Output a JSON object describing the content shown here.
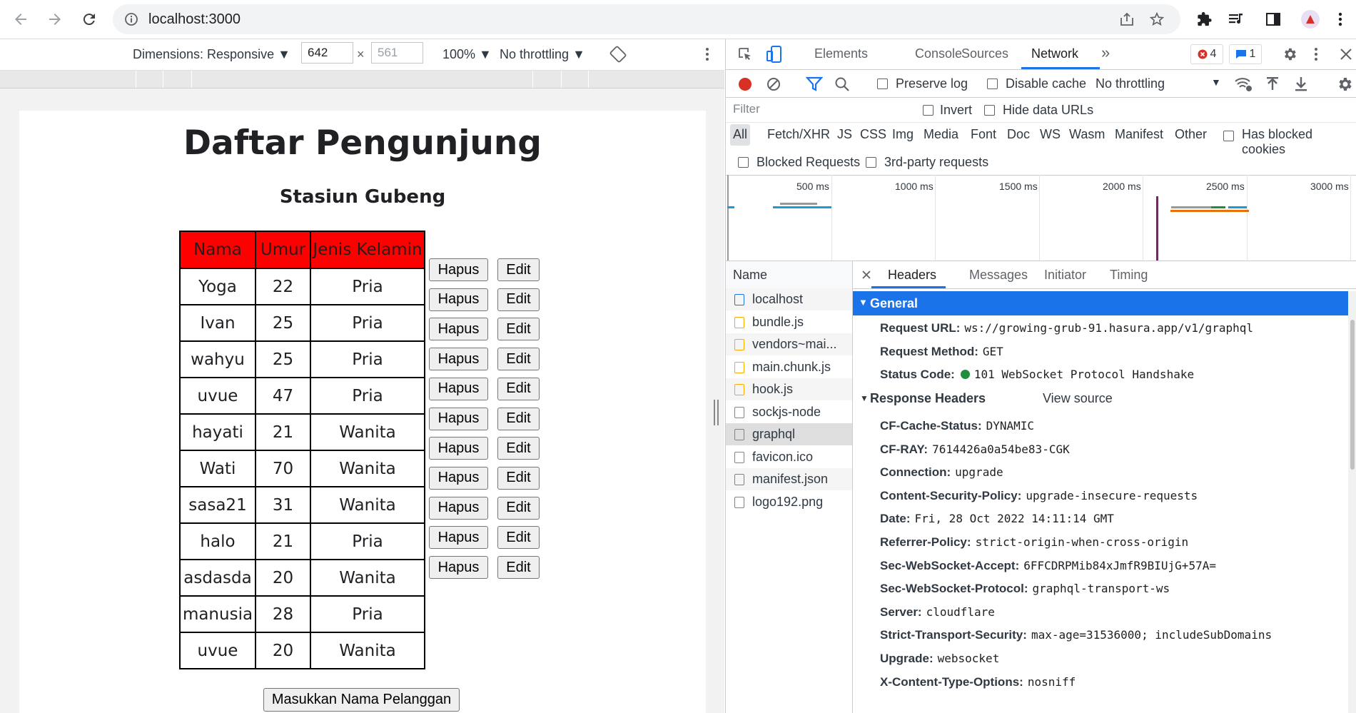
{
  "browser": {
    "url": "localhost:3000"
  },
  "device_toolbar": {
    "dimensions_label": "Dimensions: Responsive",
    "width": "642",
    "height": "561",
    "zoom": "100%",
    "throttling": "No throttling"
  },
  "app": {
    "title": "Daftar Pengunjung",
    "subtitle": "Stasiun Gubeng",
    "columns": [
      "Nama",
      "Umur",
      "Jenis Kelamin"
    ],
    "rows": [
      {
        "nama": "Yoga",
        "umur": "22",
        "jk": "Pria"
      },
      {
        "nama": "Ivan",
        "umur": "25",
        "jk": "Pria"
      },
      {
        "nama": "wahyu",
        "umur": "25",
        "jk": "Pria"
      },
      {
        "nama": "uvue",
        "umur": "47",
        "jk": "Pria"
      },
      {
        "nama": "hayati",
        "umur": "21",
        "jk": "Wanita"
      },
      {
        "nama": "Wati",
        "umur": "70",
        "jk": "Wanita"
      },
      {
        "nama": "sasa21",
        "umur": "31",
        "jk": "Wanita"
      },
      {
        "nama": "halo",
        "umur": "21",
        "jk": "Pria"
      },
      {
        "nama": "asdasda",
        "umur": "20",
        "jk": "Wanita"
      },
      {
        "nama": "manusia",
        "umur": "28",
        "jk": "Pria"
      },
      {
        "nama": "uvue",
        "umur": "20",
        "jk": "Wanita"
      }
    ],
    "delete_label": "Hapus",
    "edit_label": "Edit",
    "submit_label": "Masukkan Nama Pelanggan",
    "header_color": "#ff0000"
  },
  "devtools": {
    "tabs": [
      "Elements",
      "Console",
      "Sources",
      "Network"
    ],
    "more_tabs": "»",
    "error_count": "4",
    "message_count": "1",
    "toolbar": {
      "preserve_log": "Preserve log",
      "disable_cache": "Disable cache",
      "throttling": "No throttling"
    },
    "filter": {
      "placeholder": "Filter",
      "invert": "Invert",
      "hide_data_urls": "Hide data URLs",
      "types": [
        "All",
        "Fetch/XHR",
        "JS",
        "CSS",
        "Img",
        "Media",
        "Font",
        "Doc",
        "WS",
        "Wasm",
        "Manifest",
        "Other"
      ],
      "has_blocked_cookies": "Has blocked cookies",
      "blocked_requests": "Blocked Requests",
      "third_party": "3rd-party requests"
    },
    "overview_ticks": [
      "500 ms",
      "1000 ms",
      "1500 ms",
      "2000 ms",
      "2500 ms",
      "3000 ms"
    ],
    "requests": {
      "header": "Name",
      "items": [
        "localhost",
        "bundle.js",
        "vendors~mai...",
        "main.chunk.js",
        "hook.js",
        "sockjs-node",
        "graphql",
        "favicon.ico",
        "manifest.json",
        "logo192.png"
      ]
    },
    "detail_tabs": [
      "Headers",
      "Messages",
      "Initiator",
      "Timing"
    ],
    "general": {
      "title": "General",
      "fields": [
        {
          "k": "Request URL:",
          "v": "ws://growing-grub-91.hasura.app/v1/graphql"
        },
        {
          "k": "Request Method:",
          "v": "GET"
        },
        {
          "k": "Status Code:",
          "v": "101 WebSocket Protocol Handshake"
        }
      ]
    },
    "response_headers": {
      "title": "Response Headers",
      "view_source": "View source",
      "fields": [
        {
          "k": "CF-Cache-Status:",
          "v": "DYNAMIC"
        },
        {
          "k": "CF-RAY:",
          "v": "7614426a0a54be83-CGK"
        },
        {
          "k": "Connection:",
          "v": "upgrade"
        },
        {
          "k": "Content-Security-Policy:",
          "v": "upgrade-insecure-requests"
        },
        {
          "k": "Date:",
          "v": "Fri, 28 Oct 2022 14:11:14 GMT"
        },
        {
          "k": "Referrer-Policy:",
          "v": "strict-origin-when-cross-origin"
        },
        {
          "k": "Sec-WebSocket-Accept:",
          "v": "6FFCDRPMib84xJmfR9BIUjG+57A="
        },
        {
          "k": "Sec-WebSocket-Protocol:",
          "v": "graphql-transport-ws"
        },
        {
          "k": "Server:",
          "v": "cloudflare"
        },
        {
          "k": "Strict-Transport-Security:",
          "v": "max-age=31536000; includeSubDomains"
        },
        {
          "k": "Upgrade:",
          "v": "websocket"
        },
        {
          "k": "X-Content-Type-Options:",
          "v": "nosniff"
        }
      ]
    },
    "accent_color": "#1a73e8"
  }
}
